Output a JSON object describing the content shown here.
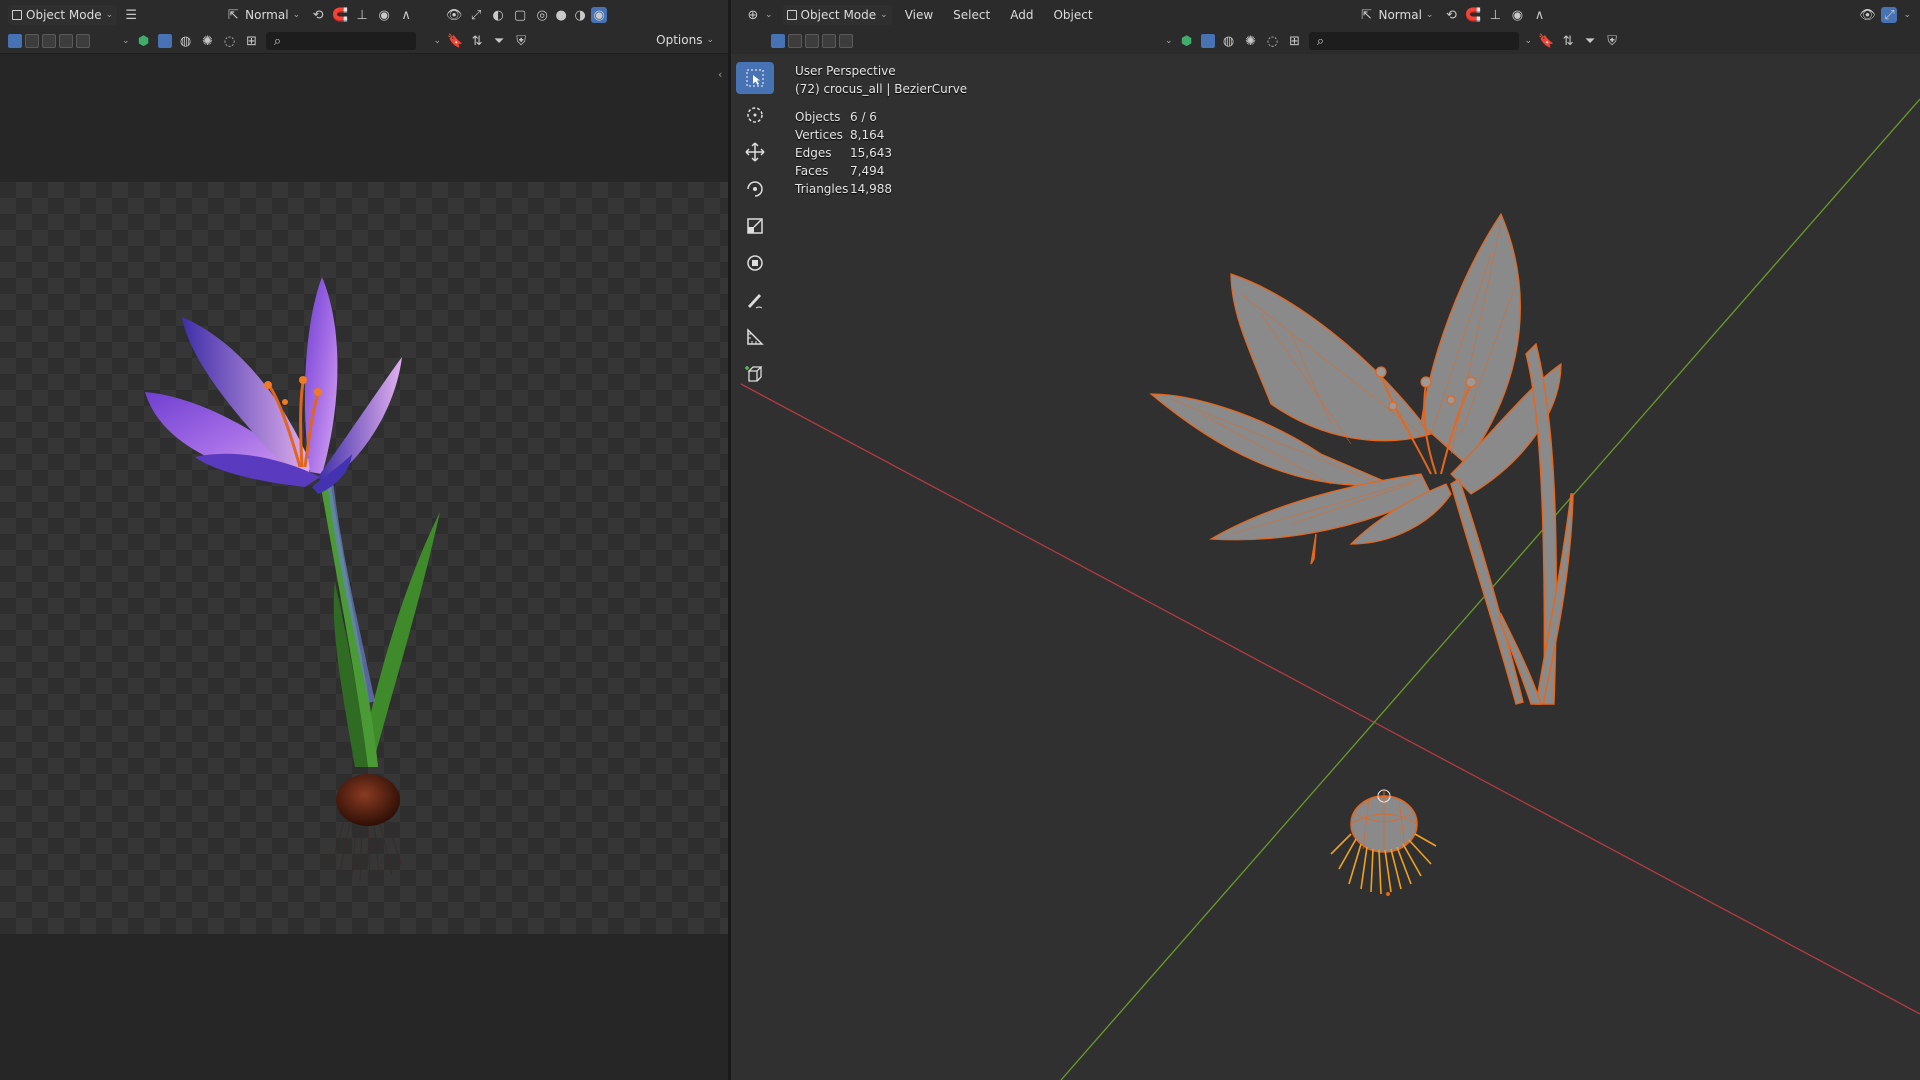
{
  "left_editor": {
    "mode": "Object Mode",
    "orientation": "Normal",
    "options": "Options",
    "search_placeholder": ""
  },
  "viewport": {
    "editor_type_icon": "viewport-icon",
    "mode": "Object Mode",
    "menus": [
      "View",
      "Select",
      "Add",
      "Object"
    ],
    "orientation": "Normal",
    "search_placeholder": "",
    "overlay_title": "User Perspective",
    "overlay_object": "(72) crocus_all | BezierCurve",
    "stats": [
      {
        "label": "Objects",
        "value": "6 / 6"
      },
      {
        "label": "Vertices",
        "value": "8,164"
      },
      {
        "label": "Edges",
        "value": "15,643"
      },
      {
        "label": "Faces",
        "value": "7,494"
      },
      {
        "label": "Triangles",
        "value": "14,988"
      }
    ],
    "tools": [
      "select-box-icon",
      "cursor-icon",
      "move-icon",
      "rotate-icon",
      "scale-icon",
      "transform-icon",
      "annotate-icon",
      "measure-icon",
      "add-cube-icon"
    ]
  },
  "colors": {
    "selection_orange": "#e8651a",
    "active_blue": "#4772b3",
    "x_axis": "#b33a44",
    "y_axis": "#6b9a2a"
  }
}
